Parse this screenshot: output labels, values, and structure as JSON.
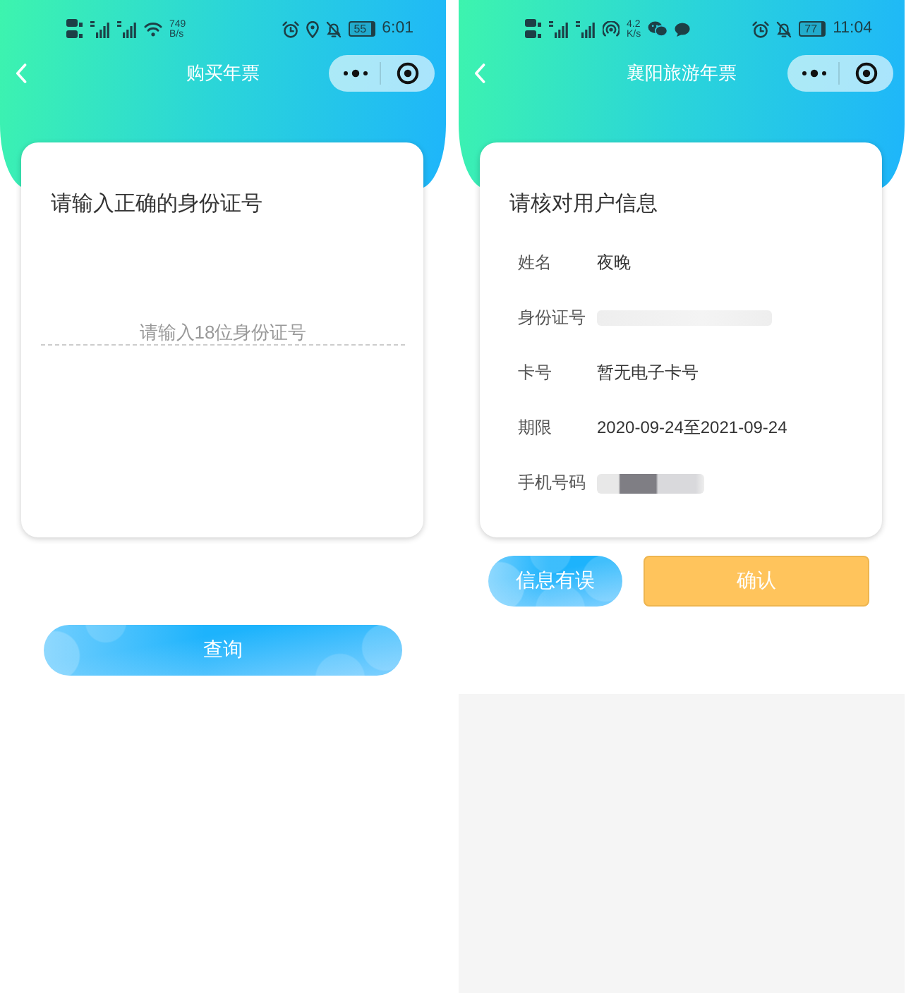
{
  "screens": [
    {
      "kind": "id_query",
      "status_bar": {
        "connection_icons": [
          {
            "kind": "hd"
          },
          {
            "kind": "signal"
          },
          {
            "kind": "signal"
          },
          {
            "kind": "wifi"
          }
        ],
        "speed_value": "749",
        "speed_unit": "B/s",
        "system_icons": [
          {
            "kind": "alarm"
          },
          {
            "kind": "location"
          },
          {
            "kind": "bell_off"
          }
        ],
        "battery": "55",
        "time": "6:01"
      },
      "nav": {
        "title": "购买年票"
      },
      "card": {
        "title": "请输入正确的身份证号",
        "input": {
          "placeholder": "请输入18位身份证号"
        }
      },
      "buttons": [
        {
          "kind": "pill",
          "label": "查询"
        }
      ]
    },
    {
      "kind": "info_confirm",
      "status_bar": {
        "connection_icons": [
          {
            "kind": "hd"
          },
          {
            "kind": "signal"
          },
          {
            "kind": "signal"
          },
          {
            "kind": "hotspot"
          }
        ],
        "speed_value": "4.2",
        "speed_unit": "K/s",
        "notification_icons": [
          {
            "kind": "wechat"
          },
          {
            "kind": "chat"
          }
        ],
        "system_icons": [
          {
            "kind": "alarm"
          },
          {
            "kind": "bell_off"
          }
        ],
        "battery": "77",
        "time": "11:04"
      },
      "nav": {
        "title": "襄阳旅游年票"
      },
      "card": {
        "title": "请核对用户信息",
        "rows": [
          {
            "label": "姓名",
            "kind": "text",
            "value": "夜晚"
          },
          {
            "label": "身份证号",
            "kind": "faded"
          },
          {
            "label": "卡号",
            "kind": "text",
            "value": "暂无电子卡号"
          },
          {
            "label": "期限",
            "kind": "text",
            "value": "2020-09-24至2021-09-24"
          },
          {
            "label": "手机号码",
            "kind": "masked"
          }
        ]
      },
      "buttons": [
        {
          "kind": "pill",
          "label": "信息有误"
        },
        {
          "kind": "solid",
          "label": "确认"
        }
      ]
    }
  ]
}
